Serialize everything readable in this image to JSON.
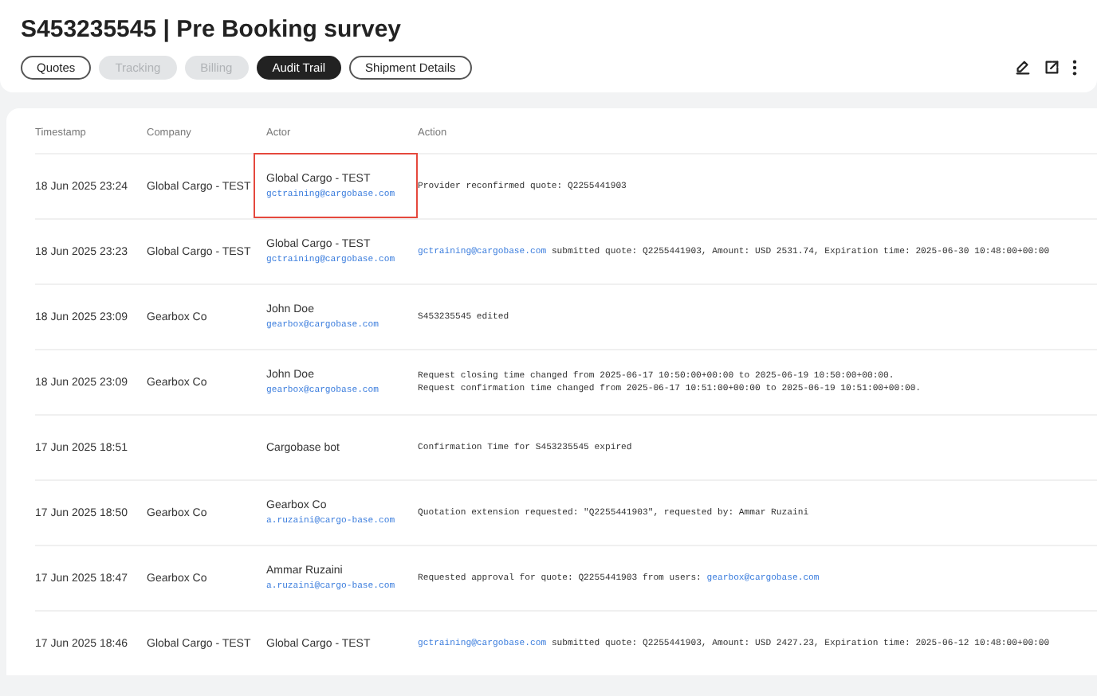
{
  "title": "S453235545 | Pre Booking survey",
  "tabs": [
    {
      "label": "Quotes",
      "selected": false,
      "disabled": false
    },
    {
      "label": "Tracking",
      "selected": false,
      "disabled": true
    },
    {
      "label": "Billing",
      "selected": false,
      "disabled": true
    },
    {
      "label": "Audit Trail",
      "selected": true,
      "disabled": false
    },
    {
      "label": "Shipment Details",
      "selected": false,
      "disabled": false
    }
  ],
  "table": {
    "columns": [
      "Timestamp",
      "Company",
      "Actor",
      "Action"
    ],
    "rows": [
      {
        "timestamp": "18 Jun 2025 23:24",
        "company": "Global Cargo - TEST",
        "actor": "Global Cargo - TEST",
        "email": "gctraining@cargobase.com",
        "highlighted": true,
        "action": [
          [
            {
              "kind": "plain",
              "text": "Provider reconfirmed quote: Q2255441903"
            }
          ]
        ]
      },
      {
        "timestamp": "18 Jun 2025 23:23",
        "company": "Global Cargo - TEST",
        "actor": "Global Cargo - TEST",
        "email": "gctraining@cargobase.com",
        "highlighted": false,
        "action": [
          [
            {
              "kind": "link",
              "text": "gctraining@cargobase.com"
            },
            {
              "kind": "plain",
              "text": "submitted quote: Q2255441903, Amount: USD 2531.74, Expiration time: 2025-06-30 10:48:00+00:00"
            }
          ]
        ]
      },
      {
        "timestamp": "18 Jun 2025 23:09",
        "company": "Gearbox Co",
        "actor": "John Doe",
        "email": "gearbox@cargobase.com",
        "highlighted": false,
        "action": [
          [
            {
              "kind": "plain",
              "text": "S453235545 edited"
            }
          ]
        ]
      },
      {
        "timestamp": "18 Jun 2025 23:09",
        "company": "Gearbox Co",
        "actor": "John Doe",
        "email": "gearbox@cargobase.com",
        "highlighted": false,
        "action": [
          [
            {
              "kind": "plain",
              "text": "Request closing time changed from 2025-06-17 10:50:00+00:00 to 2025-06-19 10:50:00+00:00."
            }
          ],
          [
            {
              "kind": "plain",
              "text": "Request confirmation time changed from 2025-06-17 10:51:00+00:00 to 2025-06-19 10:51:00+00:00."
            }
          ]
        ]
      },
      {
        "timestamp": "17 Jun 2025 18:51",
        "company": "",
        "actor": "Cargobase bot",
        "email": "",
        "highlighted": false,
        "action": [
          [
            {
              "kind": "plain",
              "text": "Confirmation Time for S453235545 expired"
            }
          ]
        ]
      },
      {
        "timestamp": "17 Jun 2025 18:50",
        "company": "Gearbox Co",
        "actor": "Gearbox Co",
        "email": "a.ruzaini@cargo-base.com",
        "highlighted": false,
        "action": [
          [
            {
              "kind": "plain",
              "text": "Quotation extension requested: \"Q2255441903\", requested by: Ammar Ruzaini"
            }
          ]
        ]
      },
      {
        "timestamp": "17 Jun 2025 18:47",
        "company": "Gearbox Co",
        "actor": "Ammar Ruzaini",
        "email": "a.ruzaini@cargo-base.com",
        "highlighted": false,
        "action": [
          [
            {
              "kind": "plain",
              "text": "Requested approval for quote: Q2255441903 from users:"
            },
            {
              "kind": "link",
              "text": "gearbox@cargobase.com"
            }
          ]
        ]
      },
      {
        "timestamp": "17 Jun 2025 18:46",
        "company": "Global Cargo - TEST",
        "actor": "Global Cargo - TEST",
        "email": "",
        "highlighted": false,
        "action": [
          [
            {
              "kind": "link",
              "text": "gctraining@cargobase.com"
            },
            {
              "kind": "plain",
              "text": "submitted quote: Q2255441903, Amount: USD 2427.23, Expiration time: 2025-06-12 10:48:00+00:00"
            }
          ]
        ]
      }
    ]
  }
}
